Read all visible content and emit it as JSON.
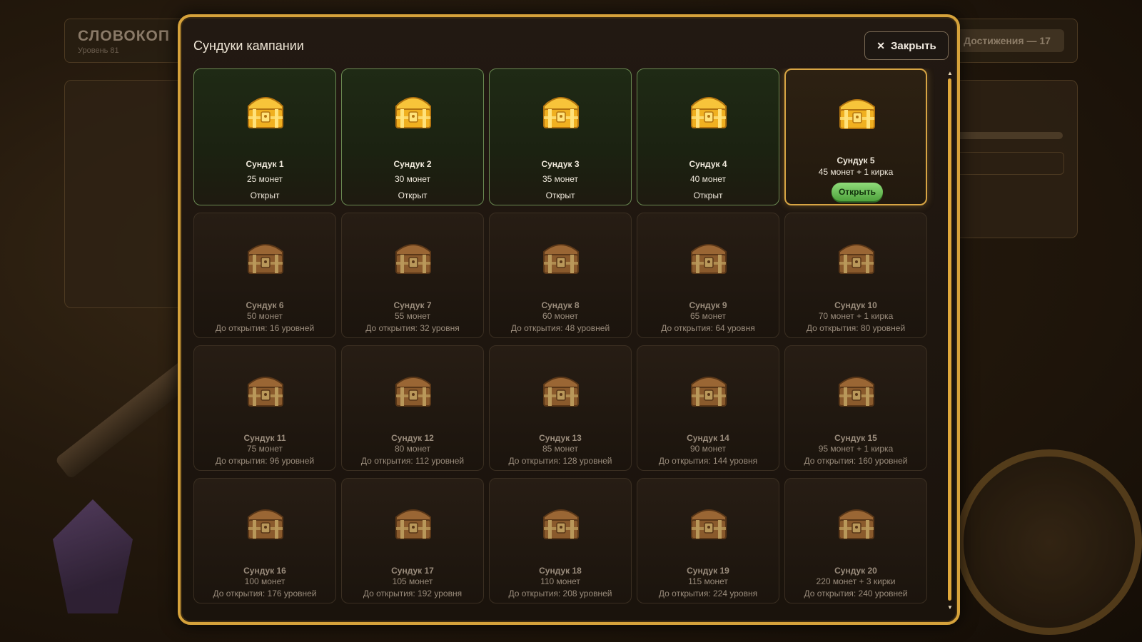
{
  "background": {
    "app_title": "СЛОВОКОП",
    "level": "Уровень 81",
    "achievements": "Достижения — 17"
  },
  "modal": {
    "title": "Сундуки кампании",
    "close_label": "Закрыть",
    "open_button_label": "Открыть"
  },
  "chests": [
    {
      "name": "Сундук 1",
      "reward": "25 монет",
      "status": "Открыт",
      "state": "opened"
    },
    {
      "name": "Сундук 2",
      "reward": "30 монет",
      "status": "Открыт",
      "state": "opened"
    },
    {
      "name": "Сундук 3",
      "reward": "35 монет",
      "status": "Открыт",
      "state": "opened"
    },
    {
      "name": "Сундук 4",
      "reward": "40 монет",
      "status": "Открыт",
      "state": "opened"
    },
    {
      "name": "Сундук 5",
      "reward": "45 монет + 1 кирка",
      "status": "",
      "state": "available"
    },
    {
      "name": "Сундук 6",
      "reward": "50 монет",
      "status": "До открытия: 16 уровней",
      "state": "locked"
    },
    {
      "name": "Сундук 7",
      "reward": "55 монет",
      "status": "До открытия: 32 уровня",
      "state": "locked"
    },
    {
      "name": "Сундук 8",
      "reward": "60 монет",
      "status": "До открытия: 48 уровней",
      "state": "locked"
    },
    {
      "name": "Сундук 9",
      "reward": "65 монет",
      "status": "До открытия: 64 уровня",
      "state": "locked"
    },
    {
      "name": "Сундук 10",
      "reward": "70 монет + 1 кирка",
      "status": "До открытия: 80 уровней",
      "state": "locked"
    },
    {
      "name": "Сундук 11",
      "reward": "75 монет",
      "status": "До открытия: 96 уровней",
      "state": "locked"
    },
    {
      "name": "Сундук 12",
      "reward": "80 монет",
      "status": "До открытия: 112 уровней",
      "state": "locked"
    },
    {
      "name": "Сундук 13",
      "reward": "85 монет",
      "status": "До открытия: 128 уровней",
      "state": "locked"
    },
    {
      "name": "Сундук 14",
      "reward": "90 монет",
      "status": "До открытия: 144 уровня",
      "state": "locked"
    },
    {
      "name": "Сундук 15",
      "reward": "95 монет + 1 кирка",
      "status": "До открытия: 160 уровней",
      "state": "locked"
    },
    {
      "name": "Сундук 16",
      "reward": "100 монет",
      "status": "До открытия: 176 уровней",
      "state": "locked"
    },
    {
      "name": "Сундук 17",
      "reward": "105 монет",
      "status": "До открытия: 192 уровня",
      "state": "locked"
    },
    {
      "name": "Сундук 18",
      "reward": "110 монет",
      "status": "До открытия: 208 уровней",
      "state": "locked"
    },
    {
      "name": "Сундук 19",
      "reward": "115 монет",
      "status": "До открытия: 224 уровня",
      "state": "locked"
    },
    {
      "name": "Сундук 20",
      "reward": "220 монет + 3 кирки",
      "status": "До открытия: 240 уровней",
      "state": "locked"
    }
  ],
  "colors": {
    "accent": "#d6a23b",
    "opened_border": "#6a8a52",
    "open_button": "#4ea23c"
  }
}
